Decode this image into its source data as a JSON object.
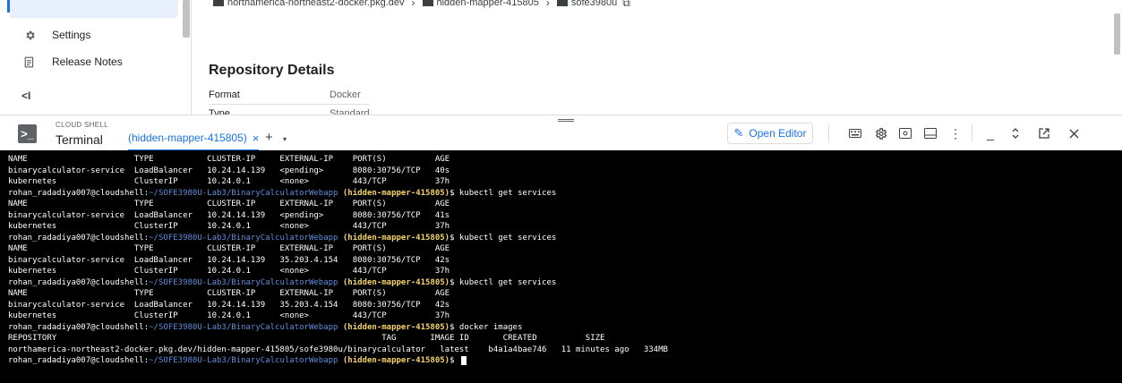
{
  "sidebar": {
    "items": [
      {
        "label": "Settings",
        "icon": "gear-icon"
      },
      {
        "label": "Release Notes",
        "icon": "release-notes-icon"
      }
    ],
    "collapse_label": "<I"
  },
  "breadcrumb": {
    "items": [
      "northamerica-northeast2-docker.pkg.dev",
      "hidden-mapper-415805",
      "sofe3980u"
    ]
  },
  "repository": {
    "title": "Repository Details",
    "rows": [
      {
        "key": "Format",
        "value": "Docker"
      },
      {
        "key": "Type",
        "value": "Standard"
      }
    ]
  },
  "shell": {
    "label": "CLOUD SHELL",
    "title": "Terminal",
    "tab_label": "(hidden-mapper-415805)",
    "tab_close": "×",
    "add_tab": "+",
    "tab_menu": "▾",
    "open_editor_label": "Open Editor"
  },
  "terminal": {
    "user_host": "rohan_radadiya007@cloudshell",
    "path": "~/SOFE3980U-Lab3/BinaryCalculatorWebapp",
    "project": "(hidden-mapper-415805)",
    "lines": [
      {
        "type": "out",
        "text": "NAME                      TYPE           CLUSTER-IP     EXTERNAL-IP    PORT(S)          AGE"
      },
      {
        "type": "out",
        "text": "binarycalculator-service  LoadBalancer   10.24.14.139   <pending>      8080:30756/TCP   40s"
      },
      {
        "type": "out",
        "text": "kubernetes                ClusterIP      10.24.0.1      <none>         443/TCP          37h"
      },
      {
        "type": "prompt",
        "cmd": "kubectl get services"
      },
      {
        "type": "out",
        "text": "NAME                      TYPE           CLUSTER-IP     EXTERNAL-IP    PORT(S)          AGE"
      },
      {
        "type": "out",
        "text": "binarycalculator-service  LoadBalancer   10.24.14.139   <pending>      8080:30756/TCP   41s"
      },
      {
        "type": "out",
        "text": "kubernetes                ClusterIP      10.24.0.1      <none>         443/TCP          37h"
      },
      {
        "type": "prompt",
        "cmd": "kubectl get services"
      },
      {
        "type": "out",
        "text": "NAME                      TYPE           CLUSTER-IP     EXTERNAL-IP    PORT(S)          AGE"
      },
      {
        "type": "out",
        "text": "binarycalculator-service  LoadBalancer   10.24.14.139   35.203.4.154   8080:30756/TCP   42s"
      },
      {
        "type": "out",
        "text": "kubernetes                ClusterIP      10.24.0.1      <none>         443/TCP          37h"
      },
      {
        "type": "prompt",
        "cmd": "kubectl get services"
      },
      {
        "type": "out",
        "text": "NAME                      TYPE           CLUSTER-IP     EXTERNAL-IP    PORT(S)          AGE"
      },
      {
        "type": "out",
        "text": "binarycalculator-service  LoadBalancer   10.24.14.139   35.203.4.154   8080:30756/TCP   42s"
      },
      {
        "type": "out",
        "text": "kubernetes                ClusterIP      10.24.0.1      <none>         443/TCP          37h"
      },
      {
        "type": "prompt",
        "cmd": "docker images"
      },
      {
        "type": "out",
        "text": "REPOSITORY                                                                   TAG       IMAGE ID       CREATED          SIZE"
      },
      {
        "type": "out",
        "text": "northamerica-northeast2-docker.pkg.dev/hidden-mapper-415805/sofe3980u/binarycalculator   latest    b4a1a4bae746   11 minutes ago   334MB"
      },
      {
        "type": "prompt",
        "cmd": "",
        "cursor": true
      }
    ]
  },
  "colors": {
    "accent": "#1a73e8",
    "terminal_bg": "#000000",
    "terminal_path": "#5c8edc",
    "terminal_project": "#f4d36b"
  }
}
